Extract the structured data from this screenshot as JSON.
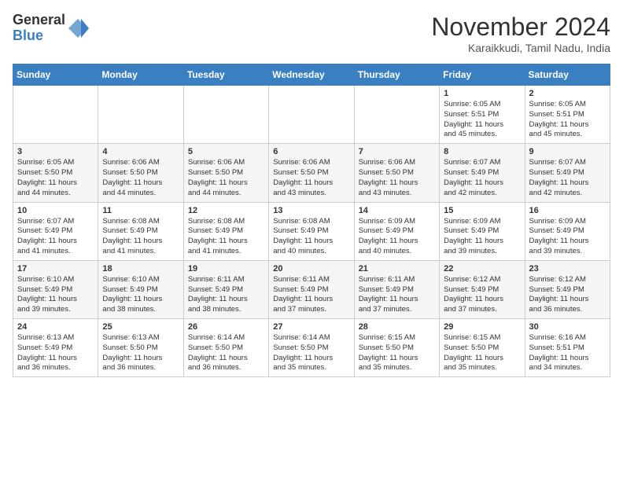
{
  "logo": {
    "general": "General",
    "blue": "Blue"
  },
  "title": "November 2024",
  "subtitle": "Karaikkudi, Tamil Nadu, India",
  "headers": [
    "Sunday",
    "Monday",
    "Tuesday",
    "Wednesday",
    "Thursday",
    "Friday",
    "Saturday"
  ],
  "weeks": [
    [
      {
        "day": "",
        "info": ""
      },
      {
        "day": "",
        "info": ""
      },
      {
        "day": "",
        "info": ""
      },
      {
        "day": "",
        "info": ""
      },
      {
        "day": "",
        "info": ""
      },
      {
        "day": "1",
        "info": "Sunrise: 6:05 AM\nSunset: 5:51 PM\nDaylight: 11 hours\nand 45 minutes."
      },
      {
        "day": "2",
        "info": "Sunrise: 6:05 AM\nSunset: 5:51 PM\nDaylight: 11 hours\nand 45 minutes."
      }
    ],
    [
      {
        "day": "3",
        "info": "Sunrise: 6:05 AM\nSunset: 5:50 PM\nDaylight: 11 hours\nand 44 minutes."
      },
      {
        "day": "4",
        "info": "Sunrise: 6:06 AM\nSunset: 5:50 PM\nDaylight: 11 hours\nand 44 minutes."
      },
      {
        "day": "5",
        "info": "Sunrise: 6:06 AM\nSunset: 5:50 PM\nDaylight: 11 hours\nand 44 minutes."
      },
      {
        "day": "6",
        "info": "Sunrise: 6:06 AM\nSunset: 5:50 PM\nDaylight: 11 hours\nand 43 minutes."
      },
      {
        "day": "7",
        "info": "Sunrise: 6:06 AM\nSunset: 5:50 PM\nDaylight: 11 hours\nand 43 minutes."
      },
      {
        "day": "8",
        "info": "Sunrise: 6:07 AM\nSunset: 5:49 PM\nDaylight: 11 hours\nand 42 minutes."
      },
      {
        "day": "9",
        "info": "Sunrise: 6:07 AM\nSunset: 5:49 PM\nDaylight: 11 hours\nand 42 minutes."
      }
    ],
    [
      {
        "day": "10",
        "info": "Sunrise: 6:07 AM\nSunset: 5:49 PM\nDaylight: 11 hours\nand 41 minutes."
      },
      {
        "day": "11",
        "info": "Sunrise: 6:08 AM\nSunset: 5:49 PM\nDaylight: 11 hours\nand 41 minutes."
      },
      {
        "day": "12",
        "info": "Sunrise: 6:08 AM\nSunset: 5:49 PM\nDaylight: 11 hours\nand 41 minutes."
      },
      {
        "day": "13",
        "info": "Sunrise: 6:08 AM\nSunset: 5:49 PM\nDaylight: 11 hours\nand 40 minutes."
      },
      {
        "day": "14",
        "info": "Sunrise: 6:09 AM\nSunset: 5:49 PM\nDaylight: 11 hours\nand 40 minutes."
      },
      {
        "day": "15",
        "info": "Sunrise: 6:09 AM\nSunset: 5:49 PM\nDaylight: 11 hours\nand 39 minutes."
      },
      {
        "day": "16",
        "info": "Sunrise: 6:09 AM\nSunset: 5:49 PM\nDaylight: 11 hours\nand 39 minutes."
      }
    ],
    [
      {
        "day": "17",
        "info": "Sunrise: 6:10 AM\nSunset: 5:49 PM\nDaylight: 11 hours\nand 39 minutes."
      },
      {
        "day": "18",
        "info": "Sunrise: 6:10 AM\nSunset: 5:49 PM\nDaylight: 11 hours\nand 38 minutes."
      },
      {
        "day": "19",
        "info": "Sunrise: 6:11 AM\nSunset: 5:49 PM\nDaylight: 11 hours\nand 38 minutes."
      },
      {
        "day": "20",
        "info": "Sunrise: 6:11 AM\nSunset: 5:49 PM\nDaylight: 11 hours\nand 37 minutes."
      },
      {
        "day": "21",
        "info": "Sunrise: 6:11 AM\nSunset: 5:49 PM\nDaylight: 11 hours\nand 37 minutes."
      },
      {
        "day": "22",
        "info": "Sunrise: 6:12 AM\nSunset: 5:49 PM\nDaylight: 11 hours\nand 37 minutes."
      },
      {
        "day": "23",
        "info": "Sunrise: 6:12 AM\nSunset: 5:49 PM\nDaylight: 11 hours\nand 36 minutes."
      }
    ],
    [
      {
        "day": "24",
        "info": "Sunrise: 6:13 AM\nSunset: 5:49 PM\nDaylight: 11 hours\nand 36 minutes."
      },
      {
        "day": "25",
        "info": "Sunrise: 6:13 AM\nSunset: 5:50 PM\nDaylight: 11 hours\nand 36 minutes."
      },
      {
        "day": "26",
        "info": "Sunrise: 6:14 AM\nSunset: 5:50 PM\nDaylight: 11 hours\nand 36 minutes."
      },
      {
        "day": "27",
        "info": "Sunrise: 6:14 AM\nSunset: 5:50 PM\nDaylight: 11 hours\nand 35 minutes."
      },
      {
        "day": "28",
        "info": "Sunrise: 6:15 AM\nSunset: 5:50 PM\nDaylight: 11 hours\nand 35 minutes."
      },
      {
        "day": "29",
        "info": "Sunrise: 6:15 AM\nSunset: 5:50 PM\nDaylight: 11 hours\nand 35 minutes."
      },
      {
        "day": "30",
        "info": "Sunrise: 6:16 AM\nSunset: 5:51 PM\nDaylight: 11 hours\nand 34 minutes."
      }
    ]
  ]
}
